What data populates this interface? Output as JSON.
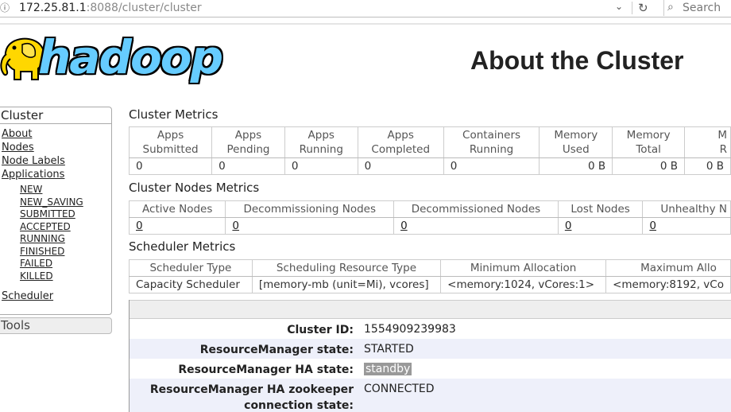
{
  "browser": {
    "url_host": "172.25.81.1",
    "url_rest": ":8088/cluster/cluster",
    "search_placeholder": "Search"
  },
  "header": {
    "logo_text": "hadoop",
    "title": "About the Cluster"
  },
  "sidebar": {
    "cluster_heading": "Cluster",
    "items": [
      "About",
      "Nodes",
      "Node Labels",
      "Applications"
    ],
    "app_states": [
      "NEW",
      "NEW_SAVING",
      "SUBMITTED",
      "ACCEPTED",
      "RUNNING",
      "FINISHED",
      "FAILED",
      "KILLED"
    ],
    "scheduler": "Scheduler",
    "tools_heading": "Tools"
  },
  "cluster_metrics": {
    "title": "Cluster Metrics",
    "headers": [
      [
        "Apps",
        "Submitted"
      ],
      [
        "Apps",
        "Pending"
      ],
      [
        "Apps",
        "Running"
      ],
      [
        "Apps",
        "Completed"
      ],
      [
        "Containers",
        "Running"
      ],
      [
        "Memory",
        "Used"
      ],
      [
        "Memory",
        "Total"
      ],
      [
        "M",
        "R"
      ]
    ],
    "values": [
      "0",
      "0",
      "0",
      "0",
      "0",
      "0 B",
      "0 B",
      "0 B"
    ]
  },
  "node_metrics": {
    "title": "Cluster Nodes Metrics",
    "headers": [
      "Active Nodes",
      "Decommissioning Nodes",
      "Decommissioned Nodes",
      "Lost Nodes",
      "Unhealthy N"
    ],
    "values": [
      "0",
      "0",
      "0",
      "0",
      "0"
    ]
  },
  "scheduler_metrics": {
    "title": "Scheduler Metrics",
    "headers": [
      "Scheduler Type",
      "Scheduling Resource Type",
      "Minimum Allocation",
      "Maximum Allo"
    ],
    "values": [
      "Capacity Scheduler",
      "[memory-mb (unit=Mi), vcores]",
      "<memory:1024, vCores:1>",
      "<memory:8192, vCo"
    ]
  },
  "info": {
    "rows": [
      {
        "key": "Cluster ID:",
        "value": "1554909239983"
      },
      {
        "key": "ResourceManager state:",
        "value": "STARTED"
      },
      {
        "key": "ResourceManager HA state:",
        "value": "standby"
      },
      {
        "key": "ResourceManager HA zookeeper connection state:",
        "value": "CONNECTED"
      }
    ]
  }
}
